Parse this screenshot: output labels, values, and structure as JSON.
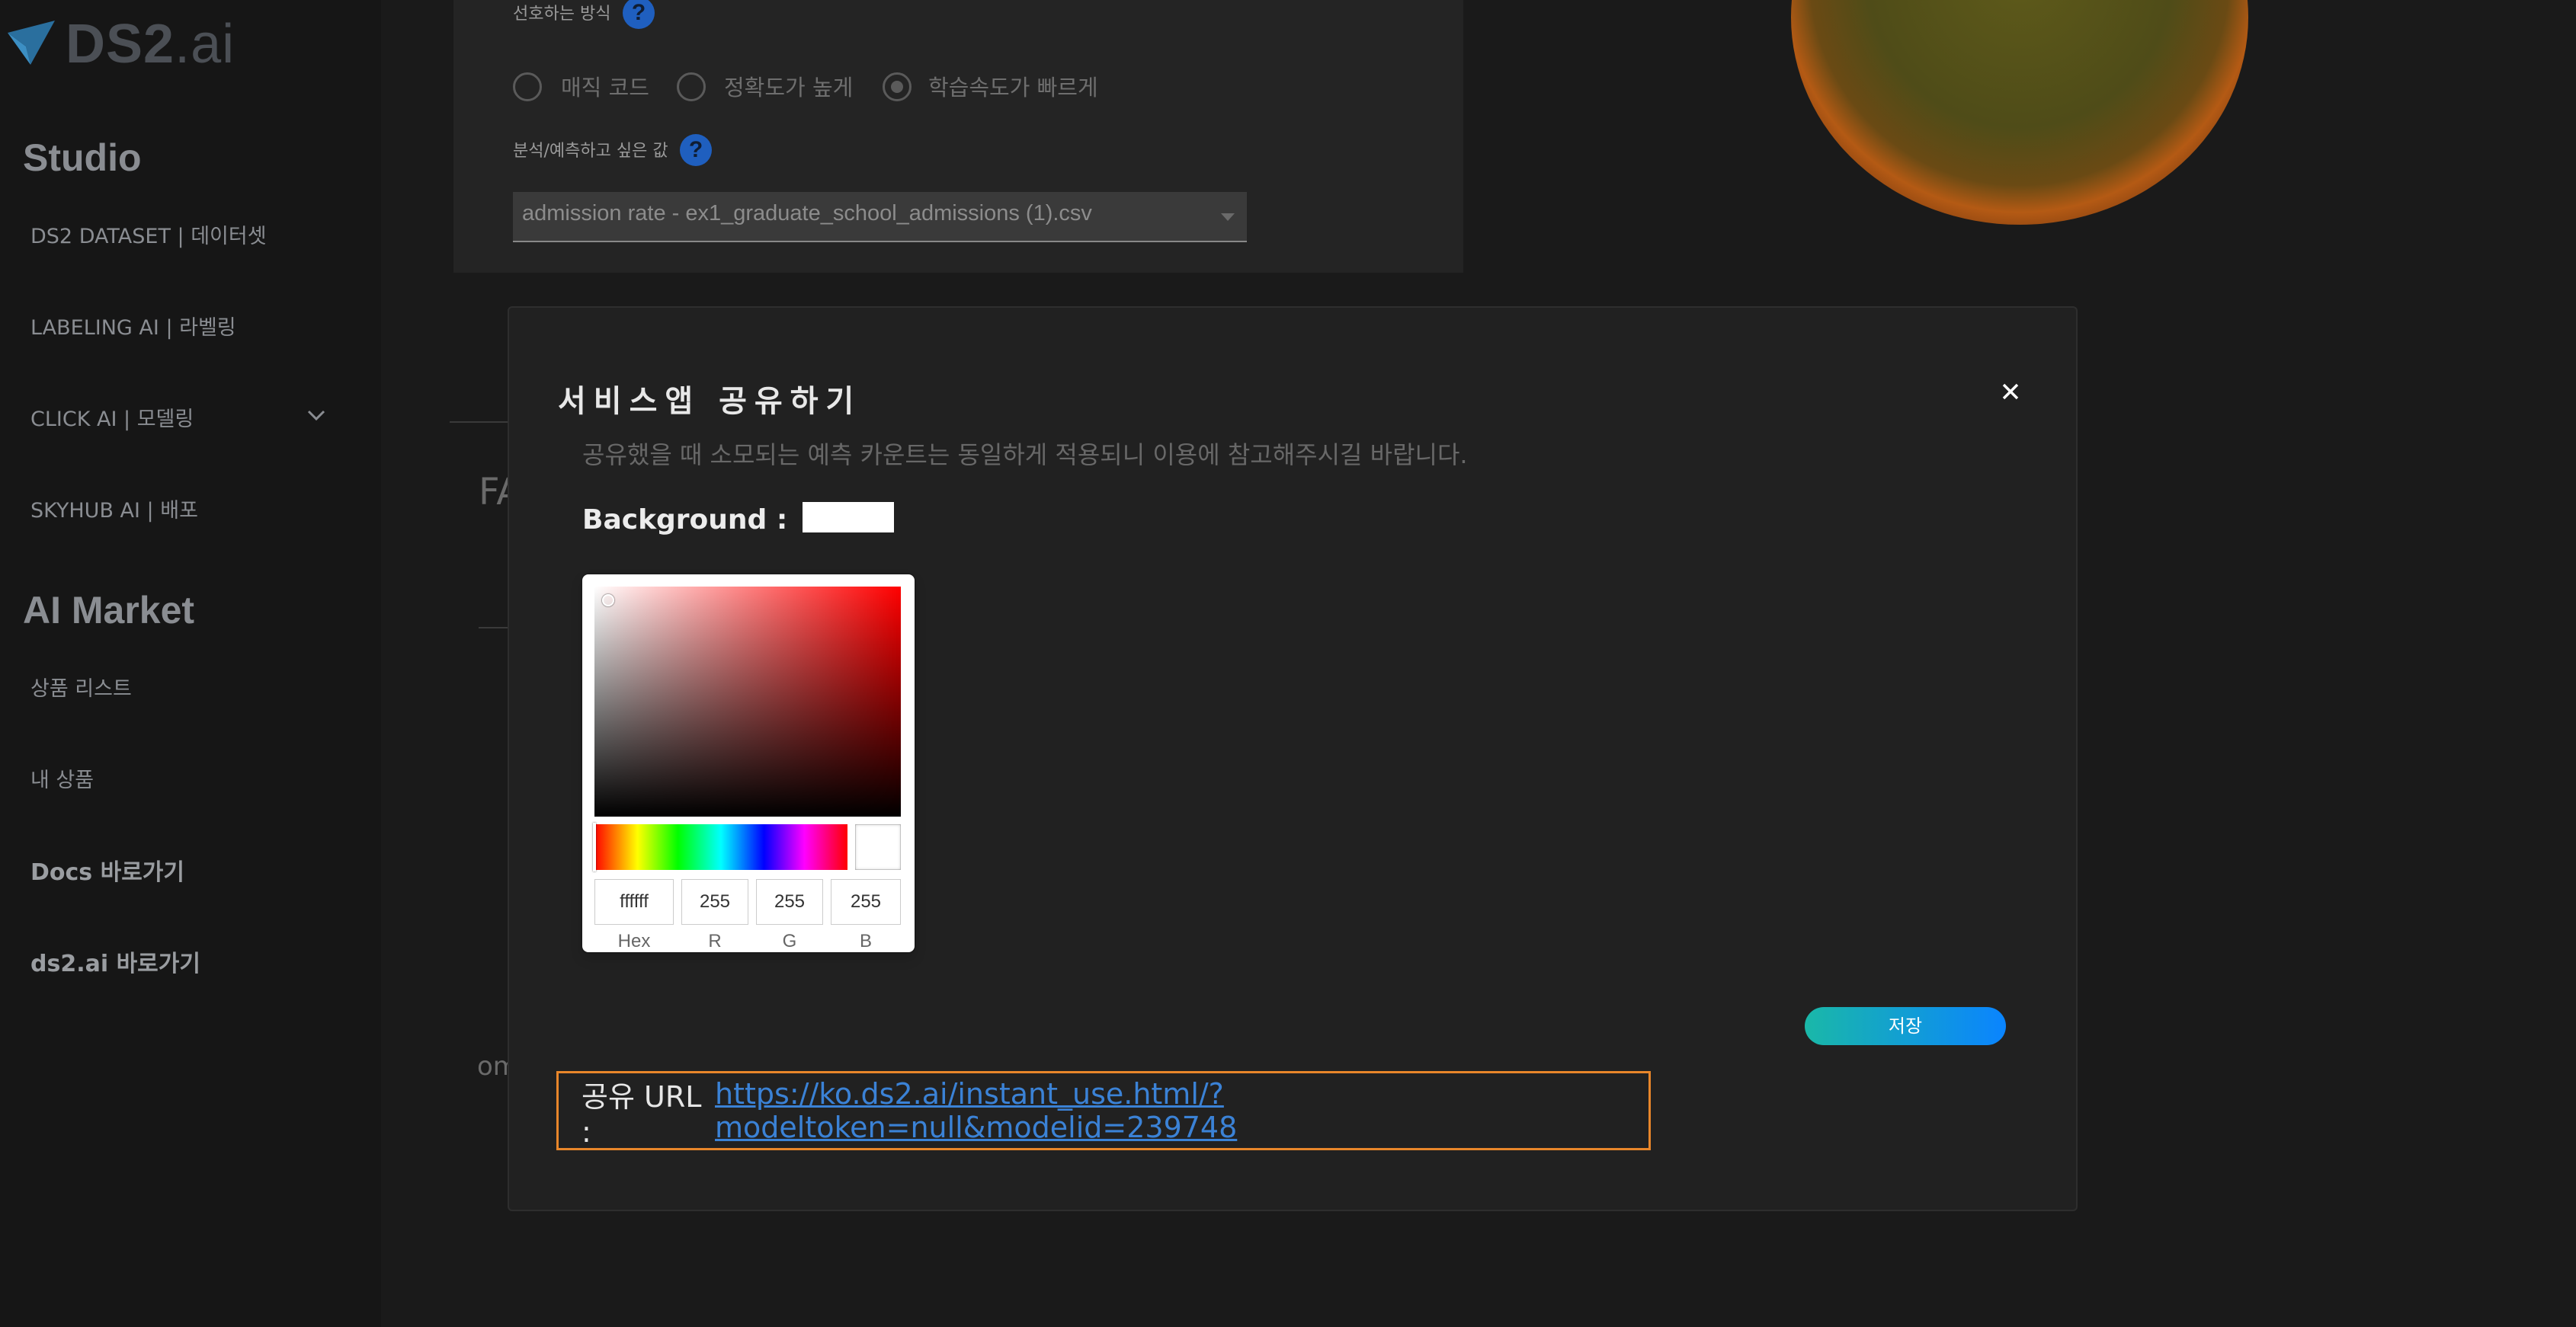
{
  "sidebar": {
    "logo_text": "DS2",
    "logo_suffix": ".ai",
    "studio_title": "Studio",
    "studio_items": [
      "DS2 DATASET | 데이터셋",
      "LABELING AI | 라벨링",
      "CLICK AI | 모델링",
      "SKYHUB AI | 배포"
    ],
    "market_title": "AI Market",
    "market_items": [
      "상품 리스트",
      "내 상품"
    ],
    "links": [
      "Docs 바로가기",
      "ds2.ai 바로가기"
    ]
  },
  "background": {
    "method_label": "선호하는 방식",
    "options": [
      "매직 코드",
      "정확도가 높게",
      "학습속도가 빠르게"
    ],
    "selected_option": "학습속도가 빠르게",
    "target_label": "분석/예측하고 싶은 값",
    "target_value": "admission rate - ex1_graduate_school_admissions (1).csv",
    "faint_text_1": "FA",
    "faint_text_2": "om"
  },
  "modal": {
    "title": "서비스앱 공유하기",
    "description": "공유했을 때 소모되는 예측 카운트는 동일하게 적용되니 이용에 참고해주시길 바랍니다.",
    "background_label": "Background :",
    "background_color": "#ffffff",
    "picker": {
      "hex": "ffffff",
      "r": "255",
      "g": "255",
      "b": "255",
      "labels": [
        "Hex",
        "R",
        "G",
        "B"
      ]
    },
    "save_label": "저장",
    "url_label": "공유 URL :",
    "url": "https://ko.ds2.ai/instant_use.html/?modeltoken=null&modelid=239748"
  }
}
